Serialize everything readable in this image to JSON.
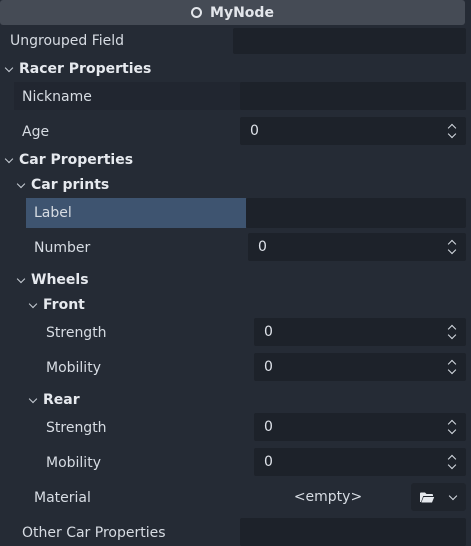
{
  "header": {
    "title": "MyNode",
    "icon": "node-circle-icon"
  },
  "ungrouped": {
    "label": "Ungrouped Field"
  },
  "racer": {
    "title": "Racer Properties",
    "nickname_label": "Nickname",
    "age_label": "Age",
    "age_value": "0"
  },
  "car": {
    "title": "Car Properties",
    "prints": {
      "title": "Car prints",
      "label_label": "Label",
      "number_label": "Number",
      "number_value": "0"
    },
    "wheels": {
      "title": "Wheels",
      "front": {
        "title": "Front",
        "strength_label": "Strength",
        "strength_value": "0",
        "mobility_label": "Mobility",
        "mobility_value": "0"
      },
      "rear": {
        "title": "Rear",
        "strength_label": "Strength",
        "strength_value": "0",
        "mobility_label": "Mobility",
        "mobility_value": "0"
      }
    },
    "material_label": "Material",
    "material_value": "<empty>"
  },
  "other": {
    "label": "Other Car Properties"
  },
  "colors": {
    "selected_row": "#3e5470",
    "background": "#252b35"
  }
}
